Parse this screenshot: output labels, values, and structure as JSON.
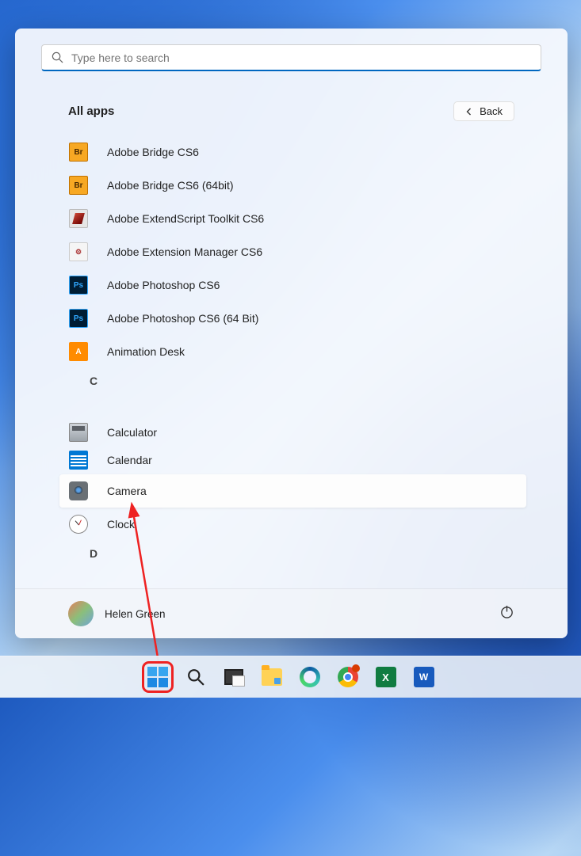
{
  "search": {
    "placeholder": "Type here to search"
  },
  "header": {
    "title": "All apps",
    "back": "Back"
  },
  "apps": {
    "bridge": "Adobe Bridge CS6",
    "bridge64": "Adobe Bridge CS6 (64bit)",
    "extendscript": "Adobe ExtendScript Toolkit CS6",
    "extmgr": "Adobe Extension Manager CS6",
    "ps": "Adobe Photoshop CS6",
    "ps64": "Adobe Photoshop CS6 (64 Bit)",
    "anim": "Animation Desk",
    "sep_c": "C",
    "calc": "Calculator",
    "calendar": "Calendar",
    "camera": "Camera",
    "clock": "Clock",
    "sep_d": "D"
  },
  "icon_text": {
    "br": "Br",
    "ps": "Ps",
    "an": "A",
    "em": "⚙"
  },
  "user": {
    "name": "Helen Green"
  },
  "taskbar": {
    "excel": "X",
    "word": "W"
  }
}
